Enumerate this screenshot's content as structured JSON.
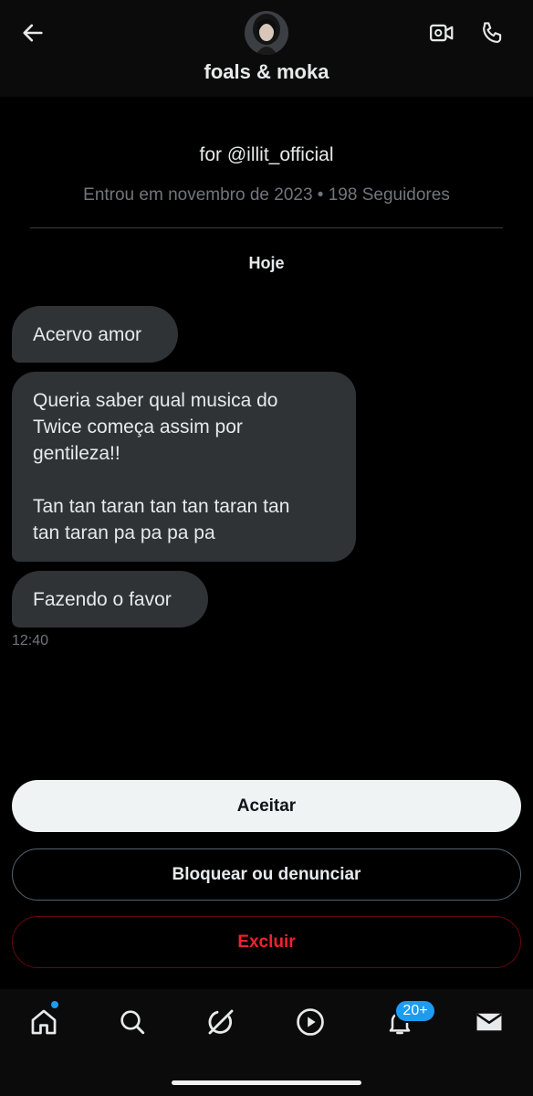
{
  "header": {
    "title": "foals & moka",
    "back_icon": "arrow-left-icon",
    "video_icon": "video-call-icon",
    "phone_icon": "phone-icon"
  },
  "profile": {
    "bio": "for @illit_official",
    "meta": "Entrou em novembro de 2023 • 198 Seguidores"
  },
  "conversation": {
    "date_label": "Hoje",
    "messages": [
      {
        "text": "Acervo amor"
      },
      {
        "lines": [
          "Queria saber qual musica do",
          "Twice começa assim por",
          "gentileza!!",
          "",
          "Tan tan taran tan tan taran tan",
          "tan taran pa pa pa pa"
        ]
      },
      {
        "text": "Fazendo o favor"
      }
    ],
    "time": "12:40"
  },
  "actions": {
    "accept_label": "Aceitar",
    "block_label": "Bloquear ou denunciar",
    "delete_label": "Excluir"
  },
  "nav": {
    "items": [
      "home-icon",
      "search-icon",
      "grok-icon",
      "video-play-icon",
      "notifications-icon",
      "messages-icon"
    ],
    "notifications_badge": "20+"
  },
  "colors": {
    "background": "#000000",
    "bubble": "#2f3336",
    "accent_blue": "#1d9bf0",
    "danger_red": "#f4212e",
    "muted_text": "#71767b"
  }
}
